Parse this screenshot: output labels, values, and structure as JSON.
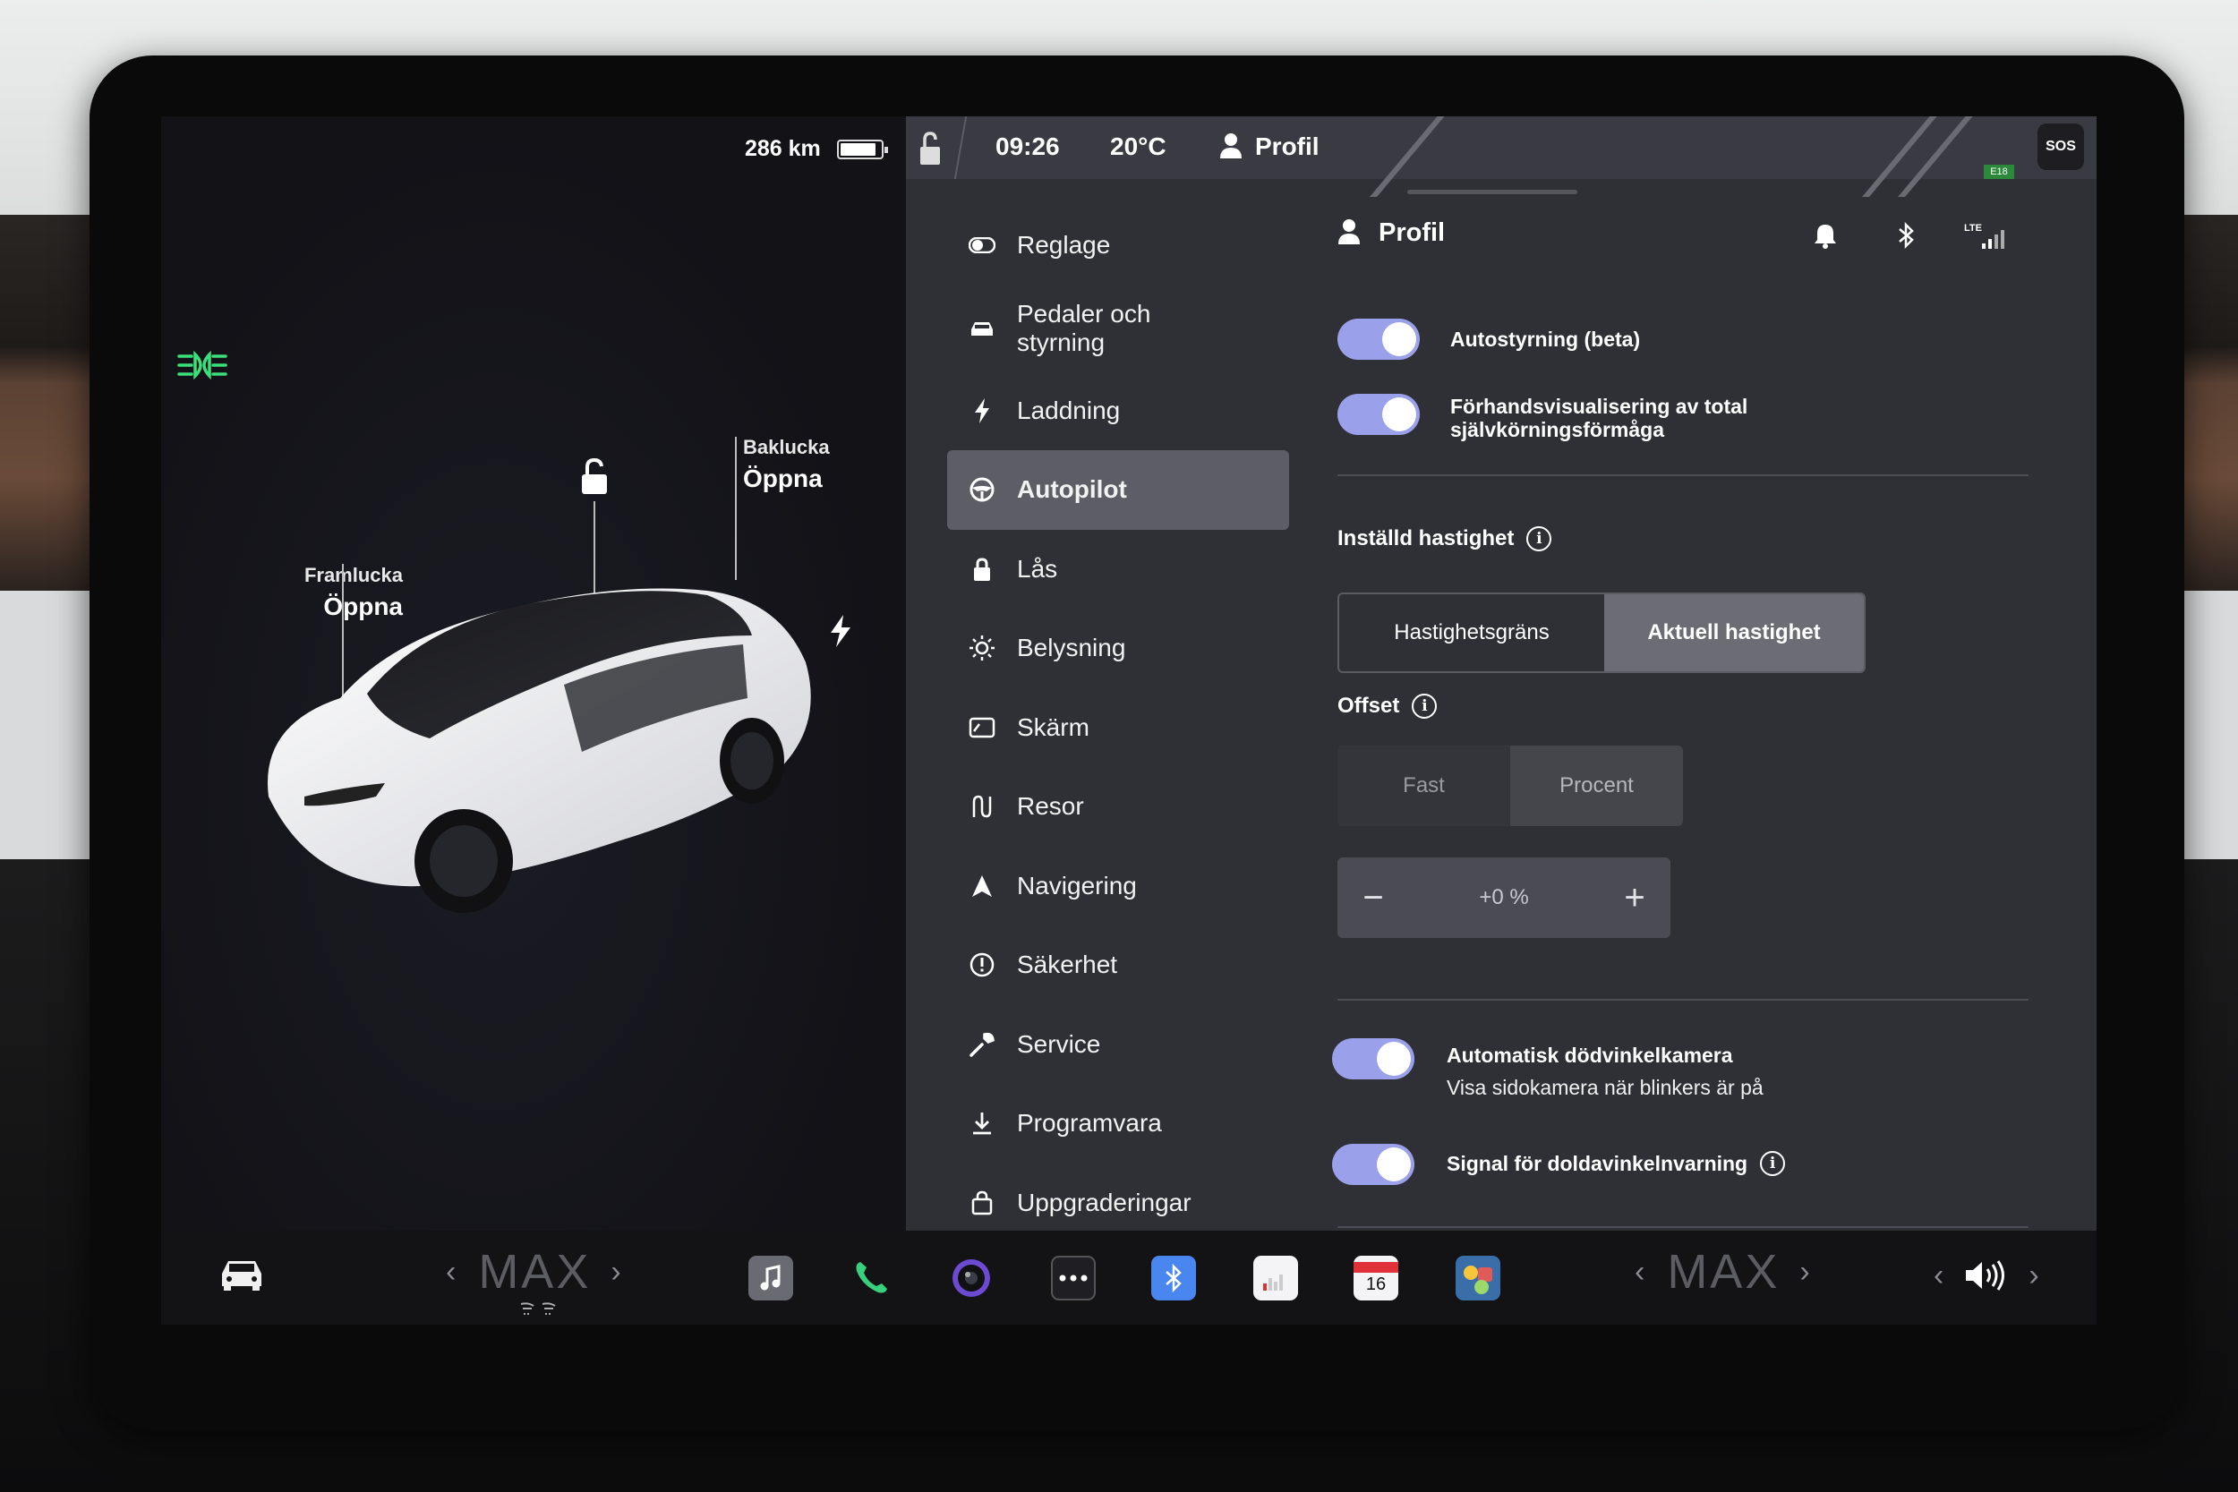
{
  "car_panel": {
    "range": "286 km",
    "battery_level": 0.9,
    "front_trunk": {
      "label": "Framlucka",
      "action": "Öppna"
    },
    "rear_trunk": {
      "label": "Baklucka",
      "action": "Öppna"
    }
  },
  "status_bar": {
    "time": "09:26",
    "temperature": "20°C",
    "profile": "Profil",
    "sos": "SOS",
    "road_tag": "E18"
  },
  "menu": {
    "items": [
      {
        "label": "Reglage",
        "icon": "toggle-icon"
      },
      {
        "label": "Pedaler och styrning",
        "icon": "car-icon"
      },
      {
        "label": "Laddning",
        "icon": "bolt-icon"
      },
      {
        "label": "Autopilot",
        "icon": "steering-wheel-icon",
        "active": true
      },
      {
        "label": "Lås",
        "icon": "lock-icon"
      },
      {
        "label": "Belysning",
        "icon": "sun-icon"
      },
      {
        "label": "Skärm",
        "icon": "display-icon"
      },
      {
        "label": "Resor",
        "icon": "trips-icon"
      },
      {
        "label": "Navigering",
        "icon": "navigation-icon"
      },
      {
        "label": "Säkerhet",
        "icon": "warning-icon"
      },
      {
        "label": "Service",
        "icon": "wrench-icon"
      },
      {
        "label": "Programvara",
        "icon": "download-icon"
      },
      {
        "label": "Uppgraderingar",
        "icon": "bag-icon"
      }
    ]
  },
  "content": {
    "profile": "Profil",
    "autosteer": {
      "label": "Autostyrning (beta)",
      "on": true
    },
    "fsd_preview": {
      "label_line1": "Förhandsvisualisering av total",
      "label_line2": "självkörningsförmåga",
      "on": true
    },
    "set_speed": {
      "title": "Inställd hastighet",
      "options": [
        "Hastighetsgräns",
        "Aktuell hastighet"
      ],
      "selected": "Aktuell hastighet"
    },
    "offset": {
      "title": "Offset",
      "options": [
        "Fast",
        "Procent"
      ],
      "selected": "Procent",
      "value": "+0 %",
      "minus": "−",
      "plus": "+"
    },
    "blind_spot_camera": {
      "label": "Automatisk dödvinkelkamera",
      "sub": "Visa sidokamera när blinkers är på",
      "on": true
    },
    "blind_spot_chime": {
      "label": "Signal för doldavinkelnvarning",
      "on": true
    }
  },
  "dock": {
    "climate_left": {
      "label": "MAX",
      "prev": "‹",
      "next": "›"
    },
    "climate_right": {
      "label": "MAX",
      "prev": "‹",
      "next": "›"
    },
    "calendar_day": "16",
    "volume_prev": "‹",
    "volume_next": "›"
  },
  "colors": {
    "toggle_on": "#9aa0ea",
    "menu_active": "#5d5e65",
    "panel_bg": "#2f3036",
    "headlight_green": "#3be07a"
  }
}
